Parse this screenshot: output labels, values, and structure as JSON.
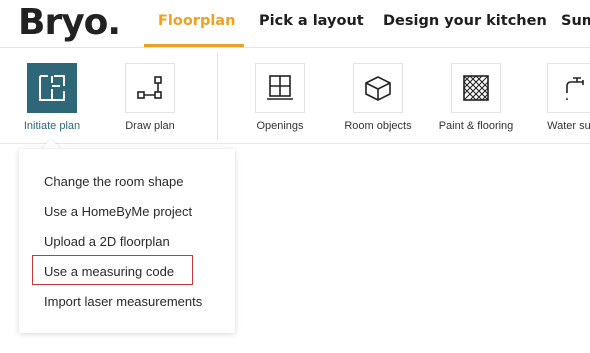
{
  "header": {
    "logo": "Bryo.",
    "tabs": [
      {
        "label": "Floorplan",
        "active": true
      },
      {
        "label": "Pick a layout",
        "active": false
      },
      {
        "label": "Design your kitchen",
        "active": false
      },
      {
        "label": "Sum",
        "active": false
      }
    ],
    "accent_color": "#f0a020"
  },
  "toolbar": {
    "tools": [
      {
        "label": "Initiate plan",
        "icon": "floorplan-icon",
        "active": true
      },
      {
        "label": "Draw plan",
        "icon": "draw-plan-icon",
        "active": false
      },
      {
        "label": "Openings",
        "icon": "window-icon",
        "active": false
      },
      {
        "label": "Room objects",
        "icon": "cube-icon",
        "active": false
      },
      {
        "label": "Paint & flooring",
        "icon": "flooring-icon",
        "active": false
      },
      {
        "label": "Water sup",
        "icon": "faucet-icon",
        "active": false
      }
    ],
    "active_color": "#2d6778"
  },
  "dropdown": {
    "items": [
      {
        "label": "Change the room shape"
      },
      {
        "label": "Use a HomeByMe project"
      },
      {
        "label": "Upload a 2D floorplan"
      },
      {
        "label": "Use a measuring code",
        "highlighted": true
      },
      {
        "label": "Import laser measurements"
      }
    ],
    "highlight_color": "#c83a3a"
  }
}
